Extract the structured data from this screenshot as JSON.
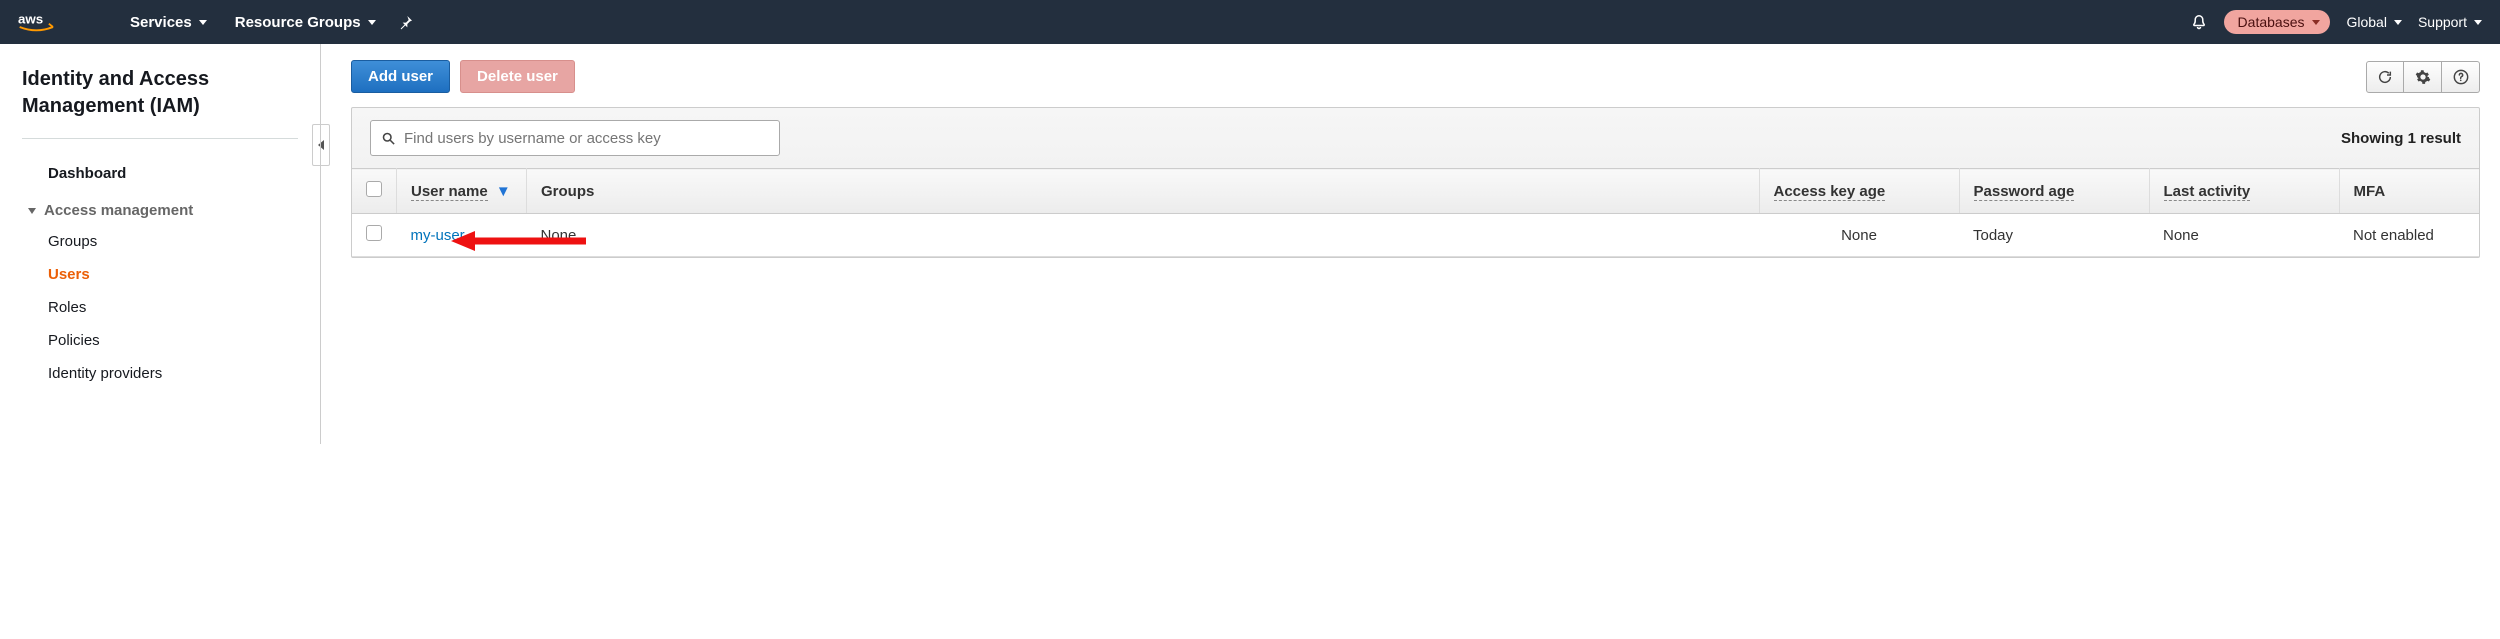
{
  "topnav": {
    "services": "Services",
    "resource_groups": "Resource Groups",
    "account_pill": "Databases",
    "region": "Global",
    "support": "Support"
  },
  "sidebar": {
    "title": "Identity and Access Management (IAM)",
    "dashboard": "Dashboard",
    "section_access": "Access management",
    "links": {
      "groups": "Groups",
      "users": "Users",
      "roles": "Roles",
      "policies": "Policies",
      "identity_providers": "Identity providers"
    }
  },
  "actions": {
    "add_user": "Add user",
    "delete_user": "Delete user"
  },
  "search": {
    "placeholder": "Find users by username or access key"
  },
  "results_label": "Showing 1 result",
  "columns": {
    "user_name": "User name",
    "groups": "Groups",
    "access_key_age": "Access key age",
    "password_age": "Password age",
    "last_activity": "Last activity",
    "mfa": "MFA"
  },
  "rows": [
    {
      "user_name": "my-user",
      "groups": "None",
      "access_key_age": "None",
      "password_age": "Today",
      "last_activity": "None",
      "mfa": "Not enabled"
    }
  ]
}
